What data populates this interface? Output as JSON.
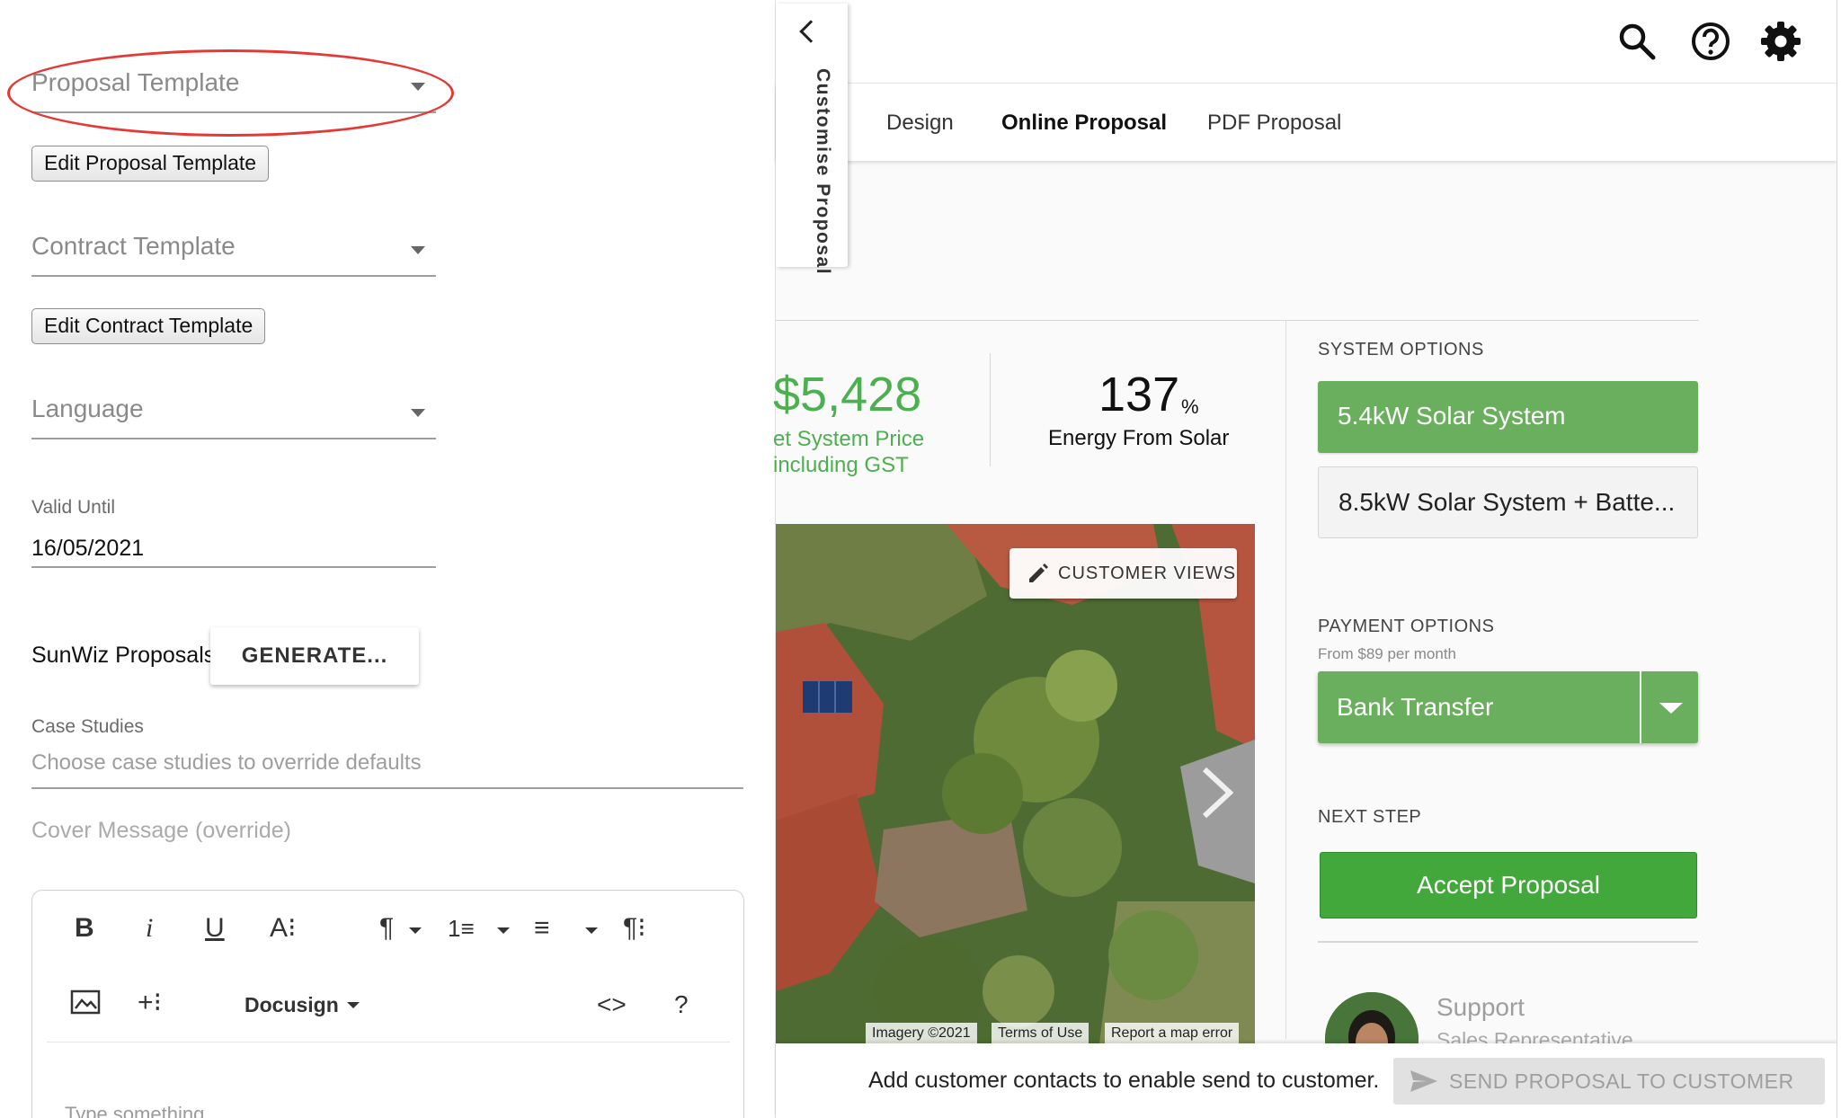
{
  "left_panel": {
    "proposal_template": {
      "placeholder": "Proposal Template"
    },
    "edit_proposal_template_label": "Edit Proposal Template",
    "contract_template": {
      "placeholder": "Contract Template"
    },
    "edit_contract_template_label": "Edit Contract Template",
    "language": {
      "placeholder": "Language"
    },
    "valid_until": {
      "label": "Valid Until",
      "value": "16/05/2021"
    },
    "sunwiz": {
      "label": "SunWiz Proposals",
      "button_label": "GENERATE..."
    },
    "case_studies": {
      "label": "Case Studies",
      "placeholder": "Choose case studies to override defaults"
    },
    "cover_message": {
      "label": "Cover Message (override)"
    },
    "editor": {
      "toolbar": {
        "bold": "B",
        "italic": "i",
        "underline": "U",
        "font_size": "A⁝",
        "paragraph_format": "¶",
        "ordered_list": "1≡",
        "unordered_list": "≡",
        "paragraph_style": "¶⁝",
        "insert_more": "+⁝",
        "docusign": "Docusign",
        "code_view": "<>",
        "help": "?"
      },
      "placeholder": "Type something"
    }
  },
  "customise_tab": {
    "label": "Customise Proposal"
  },
  "topbar": {
    "icons": [
      "search-icon",
      "help-icon",
      "gear-icon"
    ]
  },
  "tabs": [
    {
      "label": "Design",
      "active": false
    },
    {
      "label": "Online Proposal",
      "active": true
    },
    {
      "label": "PDF Proposal",
      "active": false
    }
  ],
  "summary": {
    "price": "$5,428",
    "price_label_line1": "et System Price",
    "price_label_line2": "including GST",
    "energy_value": "137",
    "energy_unit": "%",
    "energy_label": "Energy From Solar"
  },
  "map": {
    "customer_views_label": "CUSTOMER VIEWS",
    "attribution": [
      "Imagery ©2021",
      "Terms of Use",
      "Report a map error"
    ]
  },
  "system_options": {
    "heading": "SYSTEM OPTIONS",
    "options": [
      {
        "label": "5.4kW Solar System",
        "selected": true
      },
      {
        "label": "8.5kW Solar System + Batte...",
        "selected": false
      }
    ]
  },
  "payment_options": {
    "heading": "PAYMENT OPTIONS",
    "from_label": "From $89 per month",
    "selected": "Bank Transfer"
  },
  "next_step": {
    "heading": "NEXT STEP",
    "button_label": "Accept Proposal"
  },
  "support": {
    "name": "Support",
    "role": "Sales Representative"
  },
  "bottom_bar": {
    "message": "Add customer contacts to enable send to customer.",
    "send_button_label": "SEND PROPOSAL TO CUSTOMER"
  },
  "colors": {
    "accent_green": "#6aaf5d",
    "accept_green": "#43a83c",
    "price_green": "#4caf50",
    "annotation_red": "#e53935"
  }
}
